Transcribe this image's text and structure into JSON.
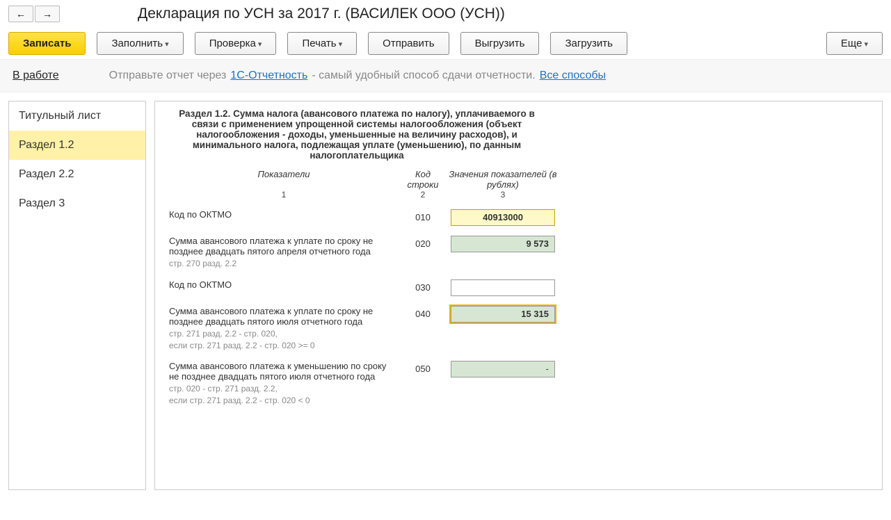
{
  "header": {
    "title": "Декларация по УСН за 2017 г. (ВАСИЛЕК ООО (УСН))"
  },
  "toolbar": {
    "write": "Записать",
    "fill": "Заполнить",
    "check": "Проверка",
    "print": "Печать",
    "send": "Отправить",
    "export": "Выгрузить",
    "import": "Загрузить",
    "more": "Еще"
  },
  "status": {
    "label": "В работе",
    "text_before": "Отправьте отчет через ",
    "link1": "1С-Отчетность",
    "text_after": " - самый удобный способ сдачи отчетности. ",
    "link2": "Все способы"
  },
  "sidebar": {
    "items": [
      {
        "label": "Титульный лист"
      },
      {
        "label": "Раздел 1.2"
      },
      {
        "label": "Раздел 2.2"
      },
      {
        "label": "Раздел 3"
      }
    ]
  },
  "section": {
    "title": "Раздел 1.2. Сумма налога (авансового платежа по налогу), уплачиваемого в связи с применением упрощенной системы налогообложения (объект налогообложения - доходы, уменьшенные на величину расходов), и минимального налога, подлежащая уплате (уменьшению), по данным налогоплательщика",
    "col_headers": {
      "c1": "Показатели",
      "c2": "Код строки",
      "c3": "Значения показателей (в рублях)"
    },
    "col_num": {
      "c1": "1",
      "c2": "2",
      "c3": "3"
    }
  },
  "rows": [
    {
      "label": "Код по ОКТМО",
      "sub": "",
      "code": "010",
      "value": "40913000",
      "type": "yellow"
    },
    {
      "label": "Сумма авансового платежа к уплате по сроку не позднее двадцать пятого апреля отчетного года",
      "sub": "стр. 270 разд. 2.2",
      "code": "020",
      "value": "9 573",
      "type": "green"
    },
    {
      "label": "Код по ОКТМО",
      "sub": "",
      "code": "030",
      "value": "",
      "type": "white"
    },
    {
      "label": "Сумма  авансового платежа к уплате по сроку не позднее двадцать пятого июля отчетного года",
      "sub": "стр. 271 разд. 2.2 - стр. 020,\nесли стр. 271 разд. 2.2 - стр. 020 >= 0",
      "code": "040",
      "value": "15 315",
      "type": "green-hl"
    },
    {
      "label": "Сумма авансового платежа к уменьшению по сроку не позднее двадцать пятого июля отчетного года",
      "sub": "стр. 020 - стр. 271 разд. 2.2,\nесли стр. 271 разд. 2.2 - стр. 020 < 0",
      "code": "050",
      "value": "-",
      "type": "green-dash"
    }
  ]
}
